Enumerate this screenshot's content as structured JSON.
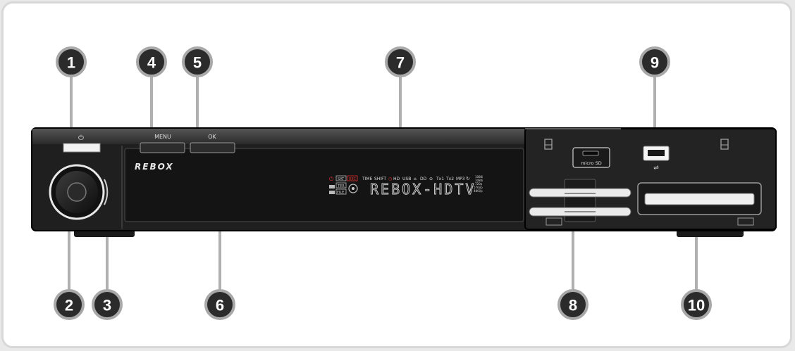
{
  "device": {
    "brand": "REBOX",
    "display_text": "REBOX-HDTV",
    "button_labels": {
      "power": "⏻",
      "menu": "MENU",
      "ok": "OK"
    },
    "front_card_label": "micro SD",
    "usb_symbol": "⇌",
    "indicators": {
      "row1": [
        "TIME",
        "SHIFT",
        "HD",
        "USB",
        "DD",
        "Tx1",
        "Tx2",
        "MP3"
      ],
      "row1_left": [
        "SAT",
        "REC"
      ],
      "row2_left": [
        "TER",
        "FILE"
      ],
      "resolutions": [
        "1080i",
        "1080i",
        "720p",
        "576i/p",
        "480i/p"
      ]
    },
    "colors": {
      "body": "#1f1f1f",
      "badge": "#2b2b2b",
      "leader": "#b0b0b0",
      "led_on": "#e53030"
    }
  },
  "callouts": [
    {
      "id": "1",
      "label": "1"
    },
    {
      "id": "2",
      "label": "2"
    },
    {
      "id": "3",
      "label": "3"
    },
    {
      "id": "4",
      "label": "4"
    },
    {
      "id": "5",
      "label": "5"
    },
    {
      "id": "6",
      "label": "6"
    },
    {
      "id": "7",
      "label": "7"
    },
    {
      "id": "8",
      "label": "8"
    },
    {
      "id": "9",
      "label": "9"
    },
    {
      "id": "10",
      "label": "10"
    }
  ]
}
